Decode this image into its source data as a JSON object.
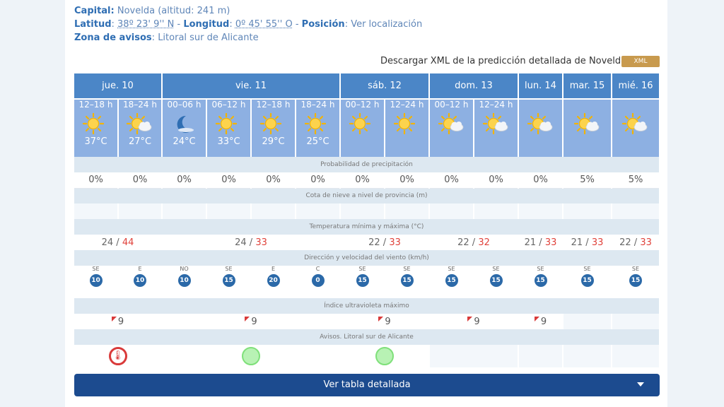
{
  "info": {
    "capital_label": "Capital:",
    "capital_value": "Novelda (altitud: 241 m)",
    "lat_label": "Latitud",
    "lat_value": "38º 23' 9'' N",
    "lon_label": "Longitud",
    "lon_value": "0º 45' 55'' O",
    "pos_label": "Posición",
    "pos_link": "Ver localización",
    "zona_label": "Zona de avisos",
    "zona_value": "Litoral sur de Alicante"
  },
  "xml": {
    "link": "Descargar XML de la predicción detallada de Novelda",
    "badge": "XML"
  },
  "days": [
    "jue. 10",
    "vie. 11",
    "sáb. 12",
    "dom. 13",
    "lun. 14",
    "mar. 15",
    "mié. 16"
  ],
  "periods": [
    {
      "label": "12–18 h",
      "icon": "sun-icon",
      "temp": "37°C"
    },
    {
      "label": "18–24 h",
      "icon": "sun-cloud-icon",
      "temp": "27°C"
    },
    {
      "label": "00–06 h",
      "icon": "moon-icon",
      "temp": "24°C"
    },
    {
      "label": "06–12 h",
      "icon": "sun-icon",
      "temp": "33°C"
    },
    {
      "label": "12–18 h",
      "icon": "sun-icon",
      "temp": "29°C"
    },
    {
      "label": "18–24 h",
      "icon": "sun-icon",
      "temp": "25°C"
    },
    {
      "label": "00–12 h",
      "icon": "sun-icon",
      "temp": ""
    },
    {
      "label": "12–24 h",
      "icon": "sun-icon",
      "temp": ""
    },
    {
      "label": "00–12 h",
      "icon": "sun-cloud-icon",
      "temp": ""
    },
    {
      "label": "12–24 h",
      "icon": "sun-cloud-icon",
      "temp": ""
    },
    {
      "label": "",
      "icon": "sun-cloud-icon",
      "temp": ""
    },
    {
      "label": "",
      "icon": "sun-cloud-icon",
      "temp": ""
    },
    {
      "label": "",
      "icon": "sun-cloud-icon",
      "temp": ""
    }
  ],
  "labels": {
    "precip": "Probabilidad de precipitación",
    "snow": "Cota de nieve a nivel de provincia (m)",
    "temp": "Temperatura mínima y máxima (°C)",
    "wind": "Dirección y velocidad del viento (km/h)",
    "uv": "Índice ultravioleta máximo",
    "avisos": "Avisos. Litoral sur de Alicante"
  },
  "precip": [
    "0%",
    "0%",
    "0%",
    "0%",
    "0%",
    "0%",
    "0%",
    "0%",
    "0%",
    "0%",
    "0%",
    "5%",
    "5%"
  ],
  "temps": [
    {
      "min": "24",
      "max": "44"
    },
    {
      "min": "24",
      "max": "33"
    },
    {
      "min": "22",
      "max": "33"
    },
    {
      "min": "22",
      "max": "32"
    },
    {
      "min": "21",
      "max": "33"
    },
    {
      "min": "21",
      "max": "33"
    },
    {
      "min": "22",
      "max": "33"
    }
  ],
  "wind": [
    {
      "dir": "SE",
      "speed": "10"
    },
    {
      "dir": "E",
      "speed": "10"
    },
    {
      "dir": "NO",
      "speed": "10"
    },
    {
      "dir": "SE",
      "speed": "15"
    },
    {
      "dir": "E",
      "speed": "20"
    },
    {
      "dir": "C",
      "speed": "0"
    },
    {
      "dir": "SE",
      "speed": "15"
    },
    {
      "dir": "SE",
      "speed": "15"
    },
    {
      "dir": "SE",
      "speed": "15"
    },
    {
      "dir": "SE",
      "speed": "15"
    },
    {
      "dir": "SE",
      "speed": "15"
    },
    {
      "dir": "SE",
      "speed": "15"
    },
    {
      "dir": "SE",
      "speed": "15"
    }
  ],
  "uv": [
    "9",
    "9",
    "9",
    "9",
    "9"
  ],
  "button": {
    "label": "Ver tabla detallada"
  },
  "colors": {
    "header": "#4b86c7",
    "period": "#8db0e2",
    "button": "#1c4b8f",
    "max_temp": "#e0413a"
  }
}
